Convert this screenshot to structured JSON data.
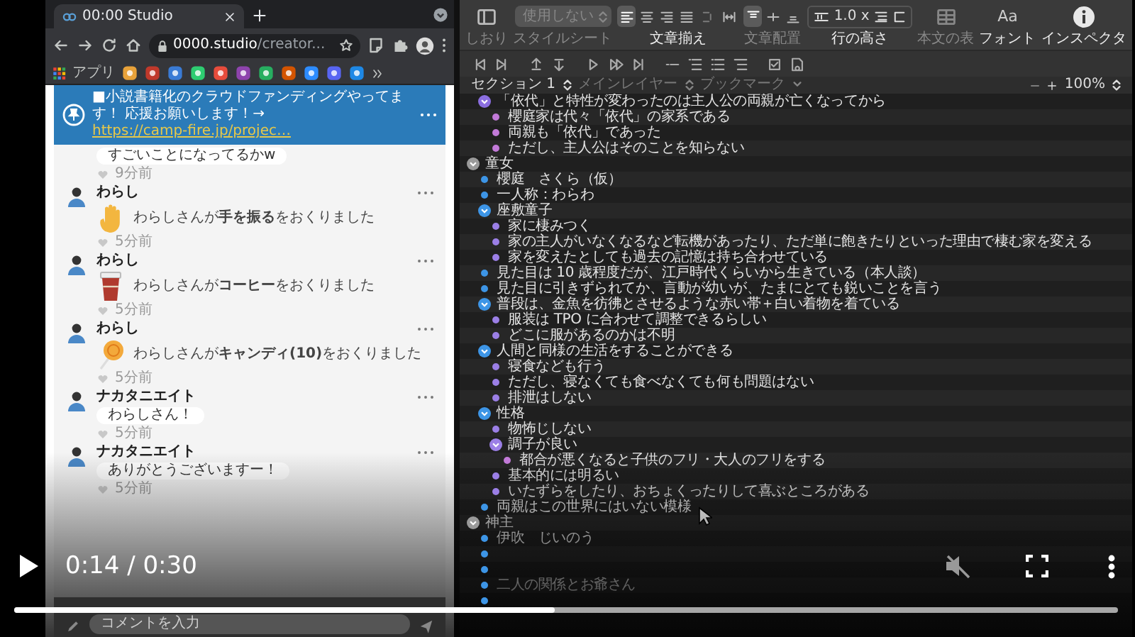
{
  "browser": {
    "tab": {
      "title": "00:00 Studio"
    },
    "url": {
      "host": "0000.studio",
      "path": "/creator..."
    },
    "bookmarks": {
      "apps_label": "アプリ"
    }
  },
  "live_page": {
    "pinned": {
      "text": "■小説書籍化のクラウドファンディングやってます！ 応援お願いします！→ ",
      "link": "https://camp-fire.jp/projec…"
    },
    "messages": [
      {
        "kind": "partial",
        "text": "すごいことになってるかw",
        "time": "9分前"
      },
      {
        "kind": "wave",
        "author": "わらし",
        "text": "わらしさんが**手を振る**をおくりました",
        "time": "5分前"
      },
      {
        "kind": "coffee",
        "author": "わらし",
        "text": "わらしさんが**コーヒー**をおくりました",
        "time": "5分前"
      },
      {
        "kind": "candy",
        "author": "わらし",
        "text": "わらしさんが**キャンディ(10)**をおくりました",
        "time": "5分前"
      },
      {
        "kind": "comment",
        "author": "ナカタニエイト",
        "text": "わらしさん！",
        "time": "5分前"
      },
      {
        "kind": "comment",
        "author": "ナカタニエイト",
        "text": "ありがとうございますー！",
        "time": "5分前"
      }
    ],
    "comment_box": {
      "placeholder": "コメントを入力"
    }
  },
  "editor": {
    "toolbar": {
      "groups": [
        {
          "kind": "sidebar",
          "label": "しおり",
          "disabled": true
        },
        {
          "kind": "dropdown",
          "label": "スタイルシート",
          "value": "使用しない",
          "disabled": true
        },
        {
          "kind": "align",
          "label": "文章揃え",
          "disabled": false,
          "options": [
            {
              "selected": true
            },
            {
              "selected": false
            },
            {
              "selected": false
            },
            {
              "selected": false
            }
          ]
        },
        {
          "kind": "valign",
          "label": "文章配置",
          "disabled": true,
          "options": [
            {
              "selected": true
            },
            {
              "selected": false
            },
            {
              "selected": false
            }
          ]
        },
        {
          "kind": "lineheight",
          "label": "行の高さ",
          "value": "1.0 x",
          "disabled": false
        },
        {
          "kind": "table",
          "label": "本文の表",
          "disabled": true
        },
        {
          "kind": "font",
          "label": "フォント",
          "glyph": "Aa",
          "disabled": false
        },
        {
          "kind": "info",
          "label": "インスペクタ",
          "disabled": false
        }
      ]
    },
    "section_bar": {
      "items": [
        {
          "text": "セクション 1",
          "disabled": false
        },
        {
          "text": "メインレイヤー",
          "disabled": true
        },
        {
          "text": "ブックマーク",
          "disabled": true
        }
      ],
      "zoom": "100%"
    },
    "outline": {
      "items": [
        {
          "children": [
            {
              "kind": "toggle",
              "color": "#8b6ee0",
              "expanded": true,
              "text": "「依代」と特性が変わったのは主人公の両親が亡くなってから",
              "children": [
                {
                  "kind": "bullet",
                  "color": "#c27ad8",
                  "text": "櫻庭家は代々「依代」の家系である"
                },
                {
                  "kind": "bullet",
                  "color": "#c27ad8",
                  "text": "両親も「依代」であった"
                },
                {
                  "kind": "bullet",
                  "color": "#c27ad8",
                  "text": "ただし、主人公はそのことを知らない"
                }
              ]
            }
          ]
        },
        {
          "kind": "toggle",
          "color": "#9a9a9a",
          "expanded": true,
          "text": "童女",
          "children": [
            {
              "kind": "bullet",
              "color": "#3d95e6",
              "text": "櫻庭　さくら（仮）"
            },
            {
              "kind": "bullet",
              "color": "#3d95e6",
              "text": "一人称：わらわ"
            },
            {
              "kind": "toggle",
              "color": "#3d95e6",
              "expanded": true,
              "text": "座敷童子",
              "children": [
                {
                  "kind": "bullet",
                  "color": "#9b7fe6",
                  "text": "家に棲みつく"
                },
                {
                  "kind": "bullet",
                  "color": "#9b7fe6",
                  "text": "家の主人がいなくなるなど転機があったり、ただ単に飽きたりといった理由で棲む家を変える"
                },
                {
                  "kind": "bullet",
                  "color": "#9b7fe6",
                  "text": "家を変えたとしても過去の記憶は持ち合わせている"
                }
              ]
            },
            {
              "kind": "bullet",
              "color": "#3d95e6",
              "text": "見た目は 10 歳程度だが、江戸時代くらいから生きている（本人談）"
            },
            {
              "kind": "bullet",
              "color": "#3d95e6",
              "text": "見た目に引きずられてか、言動が幼いが、たまにとても鋭いことを言う"
            },
            {
              "kind": "toggle",
              "color": "#3d95e6",
              "expanded": true,
              "text": "普段は、金魚を彷彿とさせるような赤い帯＋白い着物を着ている",
              "children": [
                {
                  "kind": "bullet",
                  "color": "#9b7fe6",
                  "text": "服装は TPO に合わせて調整できるらしい"
                },
                {
                  "kind": "bullet",
                  "color": "#9b7fe6",
                  "text": "どこに服があるのかは不明"
                }
              ]
            },
            {
              "kind": "toggle",
              "color": "#3d95e6",
              "expanded": true,
              "text": "人間と同様の生活をすることができる",
              "children": [
                {
                  "kind": "bullet",
                  "color": "#9b7fe6",
                  "text": "寝食なども行う"
                },
                {
                  "kind": "bullet",
                  "color": "#9b7fe6",
                  "text": "ただし、寝なくても食べなくても何も問題はない"
                },
                {
                  "kind": "bullet",
                  "color": "#9b7fe6",
                  "text": "排泄はしない"
                }
              ]
            },
            {
              "kind": "toggle",
              "color": "#3d95e6",
              "expanded": true,
              "text": "性格",
              "children": [
                {
                  "kind": "bullet",
                  "color": "#9b7fe6",
                  "text": "物怖じしない"
                },
                {
                  "kind": "toggle",
                  "color": "#9b7fe6",
                  "expanded": true,
                  "text": "調子が良い",
                  "children": [
                    {
                      "kind": "bullet",
                      "color": "#c27ad8",
                      "text": "都合が悪くなると子供のフリ・大人のフリをする"
                    }
                  ]
                },
                {
                  "kind": "bullet",
                  "color": "#9b7fe6",
                  "text": "基本的には明るい"
                },
                {
                  "kind": "bullet",
                  "color": "#9b7fe6",
                  "text": "いたずらをしたり、おちょくったりして喜ぶところがある"
                }
              ]
            },
            {
              "kind": "bullet",
              "color": "#3d95e6",
              "text": "両親はこの世界にはいない模様"
            }
          ]
        },
        {
          "kind": "toggle",
          "color": "#9a9a9a",
          "expanded": true,
          "text": "神主",
          "children": [
            {
              "kind": "bullet",
              "color": "#3d95e6",
              "text": "伊吹　じいのう"
            },
            {
              "kind": "bullet",
              "color": "#3d95e6"
            },
            {
              "kind": "bullet",
              "color": "#3d95e6"
            },
            {
              "kind": "bullet",
              "color": "#3d95e6",
              "text": "二人の関係とお爺さん"
            },
            {
              "kind": "bullet",
              "color": "#3d95e6"
            }
          ]
        }
      ]
    }
  },
  "video": {
    "playing": false,
    "time": "0:14 / 0:30",
    "level": 0.49,
    "muted": true
  }
}
